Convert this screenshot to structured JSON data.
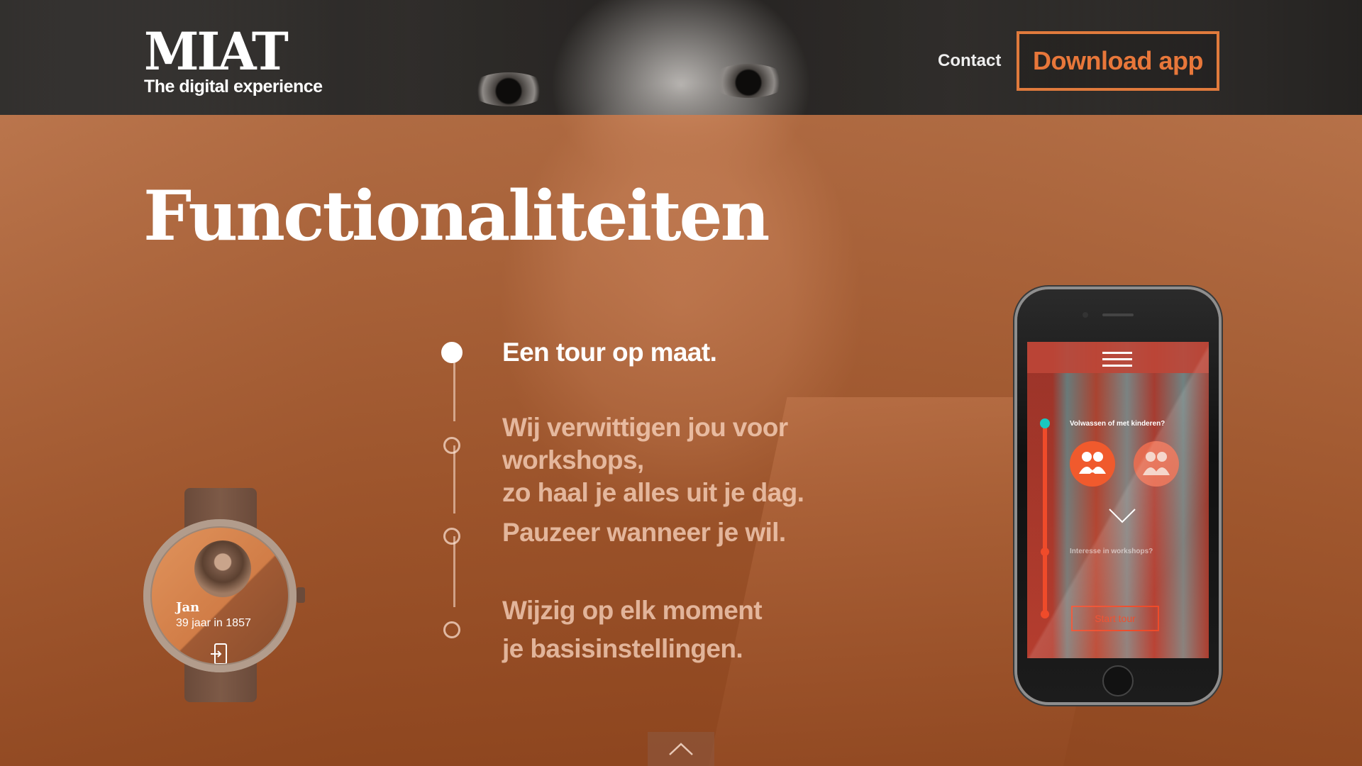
{
  "header": {
    "logo_word": "MIAT",
    "logo_tagline": "The digital experience",
    "nav_contact": "Contact",
    "download_button": "Download app"
  },
  "main": {
    "title": "Functionaliteiten",
    "features": [
      {
        "text": "Een tour op maat.",
        "active": true
      },
      {
        "text": "Wij verwittigen jou voor workshops,\nzo haal je alles uit je dag.",
        "active": false
      },
      {
        "text": "Pauzeer wanneer je wil.",
        "active": false
      },
      {
        "text": "Wijzig op elk moment\nje basisinstellingen.",
        "active": false
      }
    ]
  },
  "watch": {
    "name": "Jan",
    "subtitle": "39 jaar in 1857",
    "action_icon": "enter-app-icon"
  },
  "phone": {
    "question_1": "Volwassen of met kinderen?",
    "question_2": "Interesse in workshops?",
    "start_button": "Start tour",
    "menu_icon": "hamburger-menu-icon",
    "option_icons": [
      "adults-with-children-icon",
      "adults-icon"
    ]
  },
  "colors": {
    "accent": "#e07a3c",
    "tint": "#b8602a",
    "phone_accent": "#ef4b2a",
    "progress_start": "#19c7c0"
  },
  "scroll_up_icon": "chevron-up-icon"
}
